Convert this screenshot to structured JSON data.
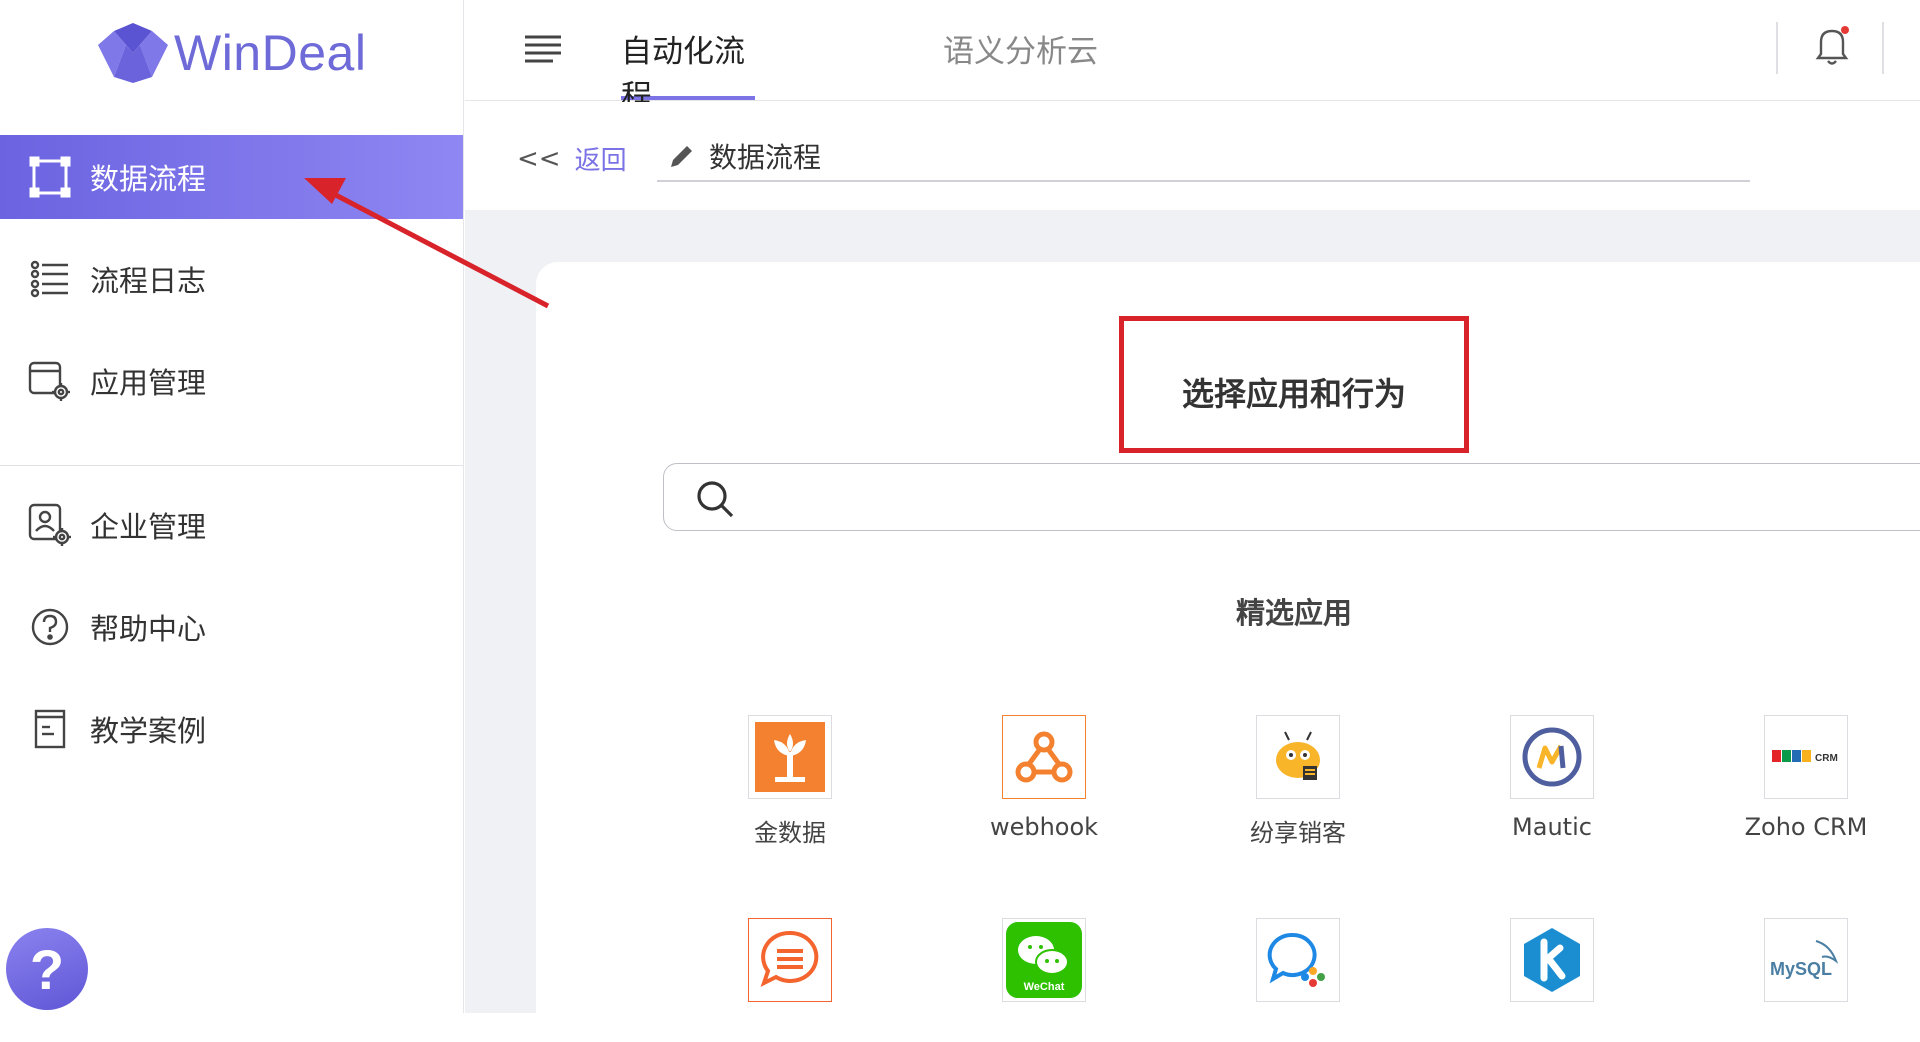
{
  "brand": {
    "name": "WinDeal",
    "color": "#6e6ad8"
  },
  "sidebar": {
    "items": [
      {
        "label": "数据流程",
        "icon": "flow-frame-icon",
        "active": true
      },
      {
        "label": "流程日志",
        "icon": "list-log-icon",
        "active": false
      },
      {
        "label": "应用管理",
        "icon": "app-settings-icon",
        "active": false
      },
      {
        "label": "企业管理",
        "icon": "enterprise-settings-icon",
        "active": false
      },
      {
        "label": "帮助中心",
        "icon": "question-circle-icon",
        "active": false
      },
      {
        "label": "教学案例",
        "icon": "document-icon",
        "active": false
      }
    ],
    "help_fab": "?"
  },
  "topbar": {
    "tabs": [
      {
        "label": "自动化流程",
        "active": true
      },
      {
        "label": "语义分析云",
        "active": false
      }
    ],
    "accent": "#7b73e6"
  },
  "subbar": {
    "back_label": "返回",
    "back_chevron": "<<",
    "crumb_title": "数据流程"
  },
  "content": {
    "heading": "选择应用和行为",
    "search_placeholder": "",
    "featured_title": "精选应用",
    "apps_row1": [
      {
        "label": "金数据",
        "icon": "jinshuju-icon"
      },
      {
        "label": "webhook",
        "icon": "webhook-icon"
      },
      {
        "label": "纷享销客",
        "icon": "fxiaoke-icon"
      },
      {
        "label": "Mautic",
        "icon": "mautic-icon"
      },
      {
        "label": "Zoho CRM",
        "icon": "zoho-crm-icon"
      }
    ],
    "apps_row2": [
      {
        "label": "",
        "icon": "chat-bubble-icon"
      },
      {
        "label": "",
        "icon": "wechat-icon"
      },
      {
        "label": "",
        "icon": "message-bubble-icon"
      },
      {
        "label": "",
        "icon": "kintone-icon"
      },
      {
        "label": "",
        "icon": "mysql-icon"
      }
    ],
    "zoho_badge": "CRM",
    "wechat_badge": "WeChat",
    "mysql_badge": "MySQL"
  },
  "annotation_color": "#d8232a"
}
